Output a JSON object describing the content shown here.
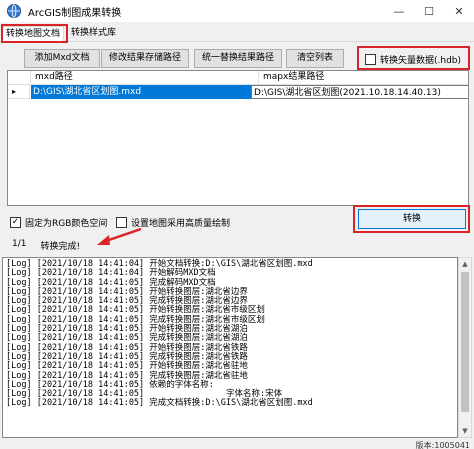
{
  "window": {
    "title": "ArcGIS制图成果转换",
    "minimize": "—",
    "maximize": "☐",
    "close": "✕"
  },
  "tabs": [
    {
      "label": "转换地图文档"
    },
    {
      "label": "转换样式库"
    }
  ],
  "toolbar": {
    "add_mxd": "添加Mxd文档",
    "modify_save_path": "修改结果存储路径",
    "unify_replace_path": "统一替换结果路径",
    "clear_list": "清空列表",
    "convert_vector_hdb": "转换矢量数据(.hdb)"
  },
  "grid": {
    "columns": [
      "mxd路径",
      "mapx结果路径"
    ],
    "rows": [
      {
        "indicator": "▸",
        "mxd_path": "D:\\GIS\\湖北省区划图.mxd",
        "mapx_path": "D:\\GIS\\湖北省区划图(2021.10.18.14.40.13)"
      }
    ]
  },
  "options": {
    "fixed_rgb": {
      "label": "固定为RGB颜色空间",
      "checked": true
    },
    "high_quality": {
      "label": "设置地图采用高质量绘制",
      "checked": false
    }
  },
  "convert_button": "转换",
  "status": {
    "progress": "1/1",
    "message": "转换完成!"
  },
  "log_lines": [
    "[Log] [2021/10/18 14:41:04] 开始文档转换:D:\\GIS\\湖北省区划图.mxd",
    "[Log] [2021/10/18 14:41:04] 开始解码MXD文档",
    "[Log] [2021/10/18 14:41:05] 完成解码MXD文档",
    "[Log] [2021/10/18 14:41:05] 开始转换图层:湖北省边界",
    "[Log] [2021/10/18 14:41:05] 完成转换图层:湖北省边界",
    "[Log] [2021/10/18 14:41:05] 开始转换图层:湖北省市级区划",
    "[Log] [2021/10/18 14:41:05] 完成转换图层:湖北省市级区划",
    "[Log] [2021/10/18 14:41:05] 开始转换图层:湖北省湖泊",
    "[Log] [2021/10/18 14:41:05] 完成转换图层:湖北省湖泊",
    "[Log] [2021/10/18 14:41:05] 开始转换图层:湖北省铁路",
    "[Log] [2021/10/18 14:41:05] 完成转换图层:湖北省铁路",
    "[Log] [2021/10/18 14:41:05] 开始转换图层:湖北省驻地",
    "[Log] [2021/10/18 14:41:05] 完成转换图层:湖北省驻地",
    "[Log] [2021/10/18 14:41:05] 依赖的字体名称:",
    "[Log] [2021/10/18 14:41:05]                字体名称:宋体",
    "[Log] [2021/10/18 14:41:05] 完成文档转换:D:\\GIS\\湖北省区划图.mxd"
  ],
  "version": "版本:1005041"
}
